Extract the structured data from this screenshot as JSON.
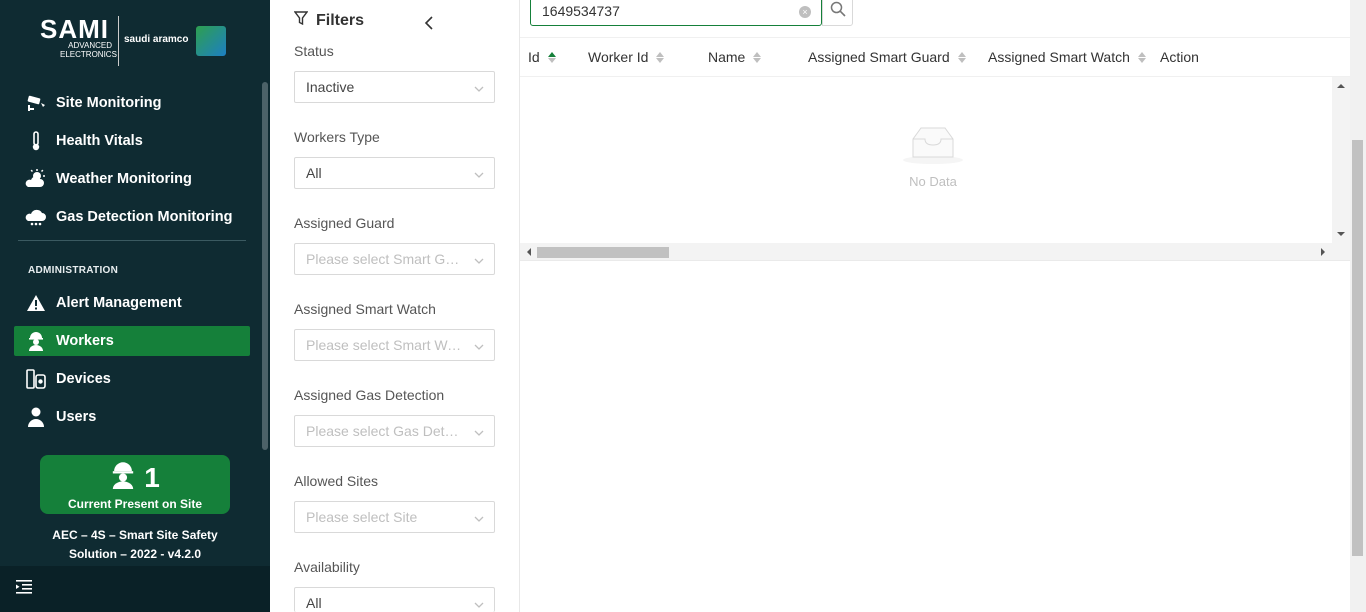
{
  "brand": {
    "logo_main": "SAMI",
    "logo_sub": "ADVANCED ELECTRONICS",
    "logo_partner": "saudi aramco"
  },
  "sidebar": {
    "items": [
      {
        "label": "Site Monitoring",
        "icon": "cctv-icon"
      },
      {
        "label": "Health Vitals",
        "icon": "thermometer-icon"
      },
      {
        "label": "Weather Monitoring",
        "icon": "sun-cloud-icon"
      },
      {
        "label": "Gas Detection Monitoring",
        "icon": "cloud-gas-icon"
      }
    ],
    "section_label": "ADMINISTRATION",
    "admin_items": [
      {
        "label": "Alert Management",
        "icon": "warning-icon"
      },
      {
        "label": "Workers",
        "icon": "worker-icon",
        "active": true
      },
      {
        "label": "Devices",
        "icon": "devices-icon"
      },
      {
        "label": "Users",
        "icon": "user-icon"
      }
    ],
    "present_count": "1",
    "present_label": "Current Present on Site",
    "version_line1": "AEC – 4S – Smart Site Safety",
    "version_line2": "Solution – 2022 - v4.2.0"
  },
  "filters": {
    "title": "Filters",
    "status_label": "Status",
    "status_value": "Inactive",
    "workers_type_label": "Workers Type",
    "workers_type_value": "All",
    "assigned_guard_label": "Assigned Guard",
    "assigned_guard_placeholder": "Please select Smart Guard",
    "assigned_watch_label": "Assigned Smart Watch",
    "assigned_watch_placeholder": "Please select Smart Watch",
    "assigned_gas_label": "Assigned Gas Detection",
    "assigned_gas_placeholder": "Please select Gas Detection",
    "allowed_sites_label": "Allowed Sites",
    "allowed_sites_placeholder": "Please select Site",
    "availability_label": "Availability",
    "availability_value": "All"
  },
  "search": {
    "value": "1649534737"
  },
  "table": {
    "columns": [
      "Id",
      "Worker Id",
      "Name",
      "Assigned Smart Guard",
      "Assigned Smart Watch",
      "Action"
    ],
    "empty_text": "No Data"
  },
  "colors": {
    "sidebar_bg": "#0f2b32",
    "accent": "#15803a"
  }
}
